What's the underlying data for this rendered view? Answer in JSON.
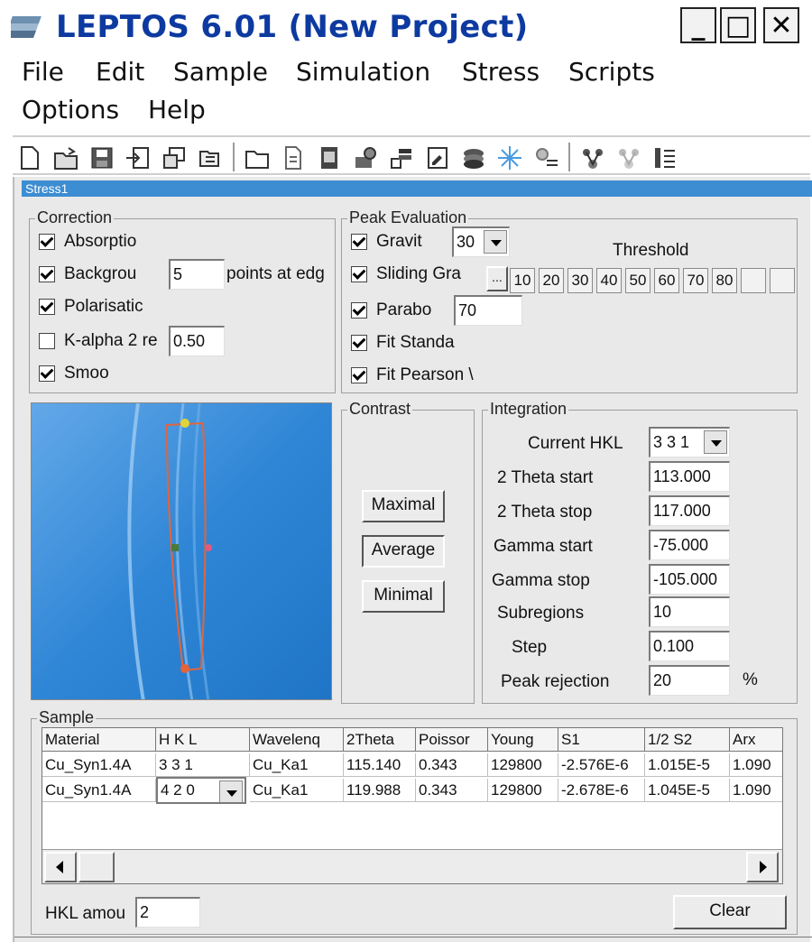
{
  "window": {
    "title": "LEPTOS 6.01 (New Project)",
    "controls": {
      "minimize": "_",
      "maximize": "□",
      "close": "✕"
    }
  },
  "menu": {
    "items": [
      "File",
      "Edit",
      "Sample",
      "Simulation",
      "Stress",
      "Scripts",
      "Options",
      "Help"
    ]
  },
  "toolbar": {
    "icons": [
      "new-file-icon",
      "open-folder-icon",
      "save-icon",
      "import-icon",
      "copy-window-icon",
      "folder-tree-icon",
      "folder-icon",
      "document-icon",
      "device-icon",
      "gear-stack-icon",
      "bar-layers-icon",
      "edit-sheet-icon",
      "stack-icon",
      "star-icon",
      "gear-list-icon",
      "molecule-icon",
      "molecule-faded-icon",
      "list-bars-icon"
    ]
  },
  "child_window": {
    "title": "Stress1"
  },
  "correction": {
    "title": "Correction",
    "absorption": {
      "label": "Absorptio",
      "checked": true
    },
    "background": {
      "label": "Backgrou",
      "checked": true,
      "value": "5",
      "suffix": "points at edg"
    },
    "polarisation": {
      "label": "Polarisatic",
      "checked": true
    },
    "kalpha": {
      "label": "K-alpha 2 re",
      "checked": false,
      "value": "0.50"
    },
    "smooth": {
      "label": "Smoo",
      "checked": true
    }
  },
  "peak_evaluation": {
    "title": "Peak Evaluation",
    "gravity": {
      "label": "Gravit",
      "checked": true,
      "value": "30"
    },
    "threshold_label": "Threshold",
    "sliding": {
      "label": "Sliding Gra",
      "checked": true,
      "button": "...",
      "values": [
        "10",
        "20",
        "30",
        "40",
        "50",
        "60",
        "70",
        "80",
        "",
        ""
      ]
    },
    "parabola": {
      "label": "Parabo",
      "checked": true,
      "value": "70"
    },
    "fit_standard": {
      "label": "Fit Standa",
      "checked": true
    },
    "fit_pearson": {
      "label": "Fit Pearson \\",
      "checked": true
    }
  },
  "contrast": {
    "title": "Contrast",
    "buttons": [
      "Maximal",
      "Average",
      "Minimal"
    ]
  },
  "integration": {
    "title": "Integration",
    "current_hkl": {
      "label": "Current HKL",
      "value": "3 3 1"
    },
    "fields": [
      {
        "label": "2 Theta start",
        "value": "113.000"
      },
      {
        "label": "2 Theta stop",
        "value": "117.000"
      },
      {
        "label": "Gamma start",
        "value": "-75.000"
      },
      {
        "label": "Gamma stop",
        "value": "-105.000"
      },
      {
        "label": "Subregions",
        "value": "10"
      },
      {
        "label": "Step",
        "value": "0.100"
      },
      {
        "label": "Peak rejection",
        "value": "20",
        "unit": "%"
      }
    ]
  },
  "sample": {
    "title": "Sample",
    "columns": [
      "Material",
      "H K L",
      "Wavelenq",
      "2Theta",
      "Poissor",
      "Young",
      "S1",
      "1/2 S2",
      "Arx"
    ],
    "rows": [
      [
        "Cu_Syn1.4A",
        "3 3 1",
        "Cu_Ka1",
        "115.140",
        "0.343",
        "129800",
        "-2.576E-6",
        "1.015E-5",
        "1.090"
      ],
      [
        "Cu_Syn1.4A",
        "4 2 0",
        "Cu_Ka1",
        "119.988",
        "0.343",
        "129800",
        "-2.678E-6",
        "1.045E-5",
        "1.090"
      ]
    ],
    "hkl_amount": {
      "label": "HKL amou",
      "value": "2"
    },
    "clear_button": "Clear"
  },
  "colors": {
    "title_text": "#0d3aa0",
    "child_title_bar": "#3d8dd2",
    "detector_blue": "#2f86d6",
    "roi_outline": "#e3643a"
  }
}
